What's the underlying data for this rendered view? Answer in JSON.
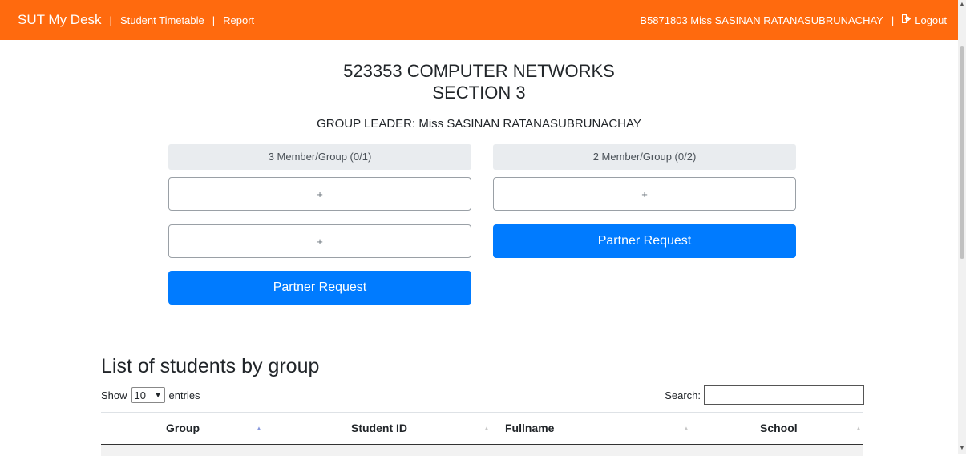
{
  "navbar": {
    "brand": "SUT My Desk",
    "sep": "|",
    "links": [
      "Student Timetable",
      "Report"
    ],
    "user": "B5871803 Miss SASINAN RATANASUBRUNACHAY",
    "logout_label": "Logout",
    "accent": "#ff6a0e"
  },
  "course": {
    "title": "523353 COMPUTER NETWORKS",
    "section": "SECTION 3",
    "leader": "GROUP LEADER: Miss SASINAN RATANASUBRUNACHAY"
  },
  "groups": {
    "left": {
      "header": "3 Member/Group (0/1)",
      "slot1": "+",
      "slot2": "+",
      "button": "Partner Request"
    },
    "right": {
      "header": "2 Member/Group (0/2)",
      "slot1": "+",
      "button": "Partner Request"
    }
  },
  "list": {
    "title": "List of students by group",
    "show_label": "Show",
    "entries_value": "10",
    "entries_label": "entries",
    "search_label": "Search:",
    "search_value": "",
    "columns": [
      "Group",
      "Student ID",
      "Fullname",
      "School"
    ]
  }
}
